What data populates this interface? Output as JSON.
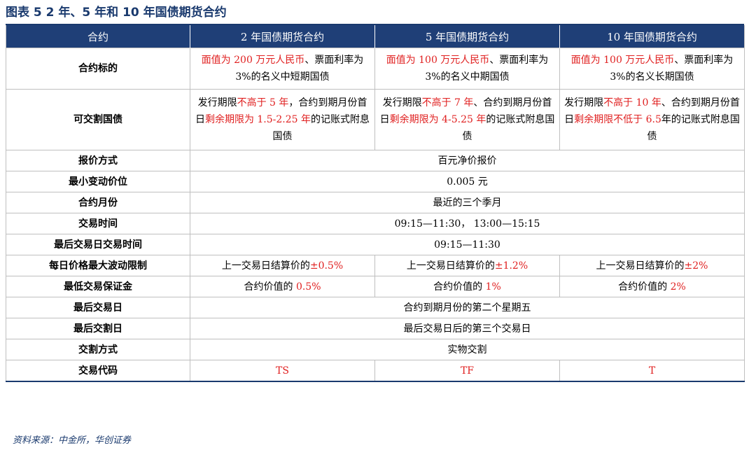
{
  "figure": {
    "title": "图表 5   2 年、5 年和 10 年国债期货合约",
    "source": "资料来源：中金所，华创证券"
  },
  "header": [
    "合约",
    "2 年国债期货合约",
    "5 年国债期货合约",
    "10 年国债期货合约"
  ],
  "rows": {
    "underlying": {
      "label": "合约标的",
      "c1": {
        "a": "面值为 200 万元人民币",
        "b": "、票面利率为 3%的名义中短期国债"
      },
      "c2": {
        "a": "面值为 100 万元人民币",
        "b": "、票面利率为 3%的名义中期国债"
      },
      "c3": {
        "a": "面值为 100 万元人民币",
        "b": "、票面利率为 3%的名义长期国债"
      }
    },
    "deliverable": {
      "label": "可交割国债",
      "c1": {
        "a": "发行期限",
        "b": "不高于 5 年",
        "c": "，合约到期月份首日",
        "d": "剩余期限为 1.5-2.25 年",
        "e": "的记账式附息国债"
      },
      "c2": {
        "a": "发行期限",
        "b": "不高于 7 年",
        "c": "、合约到期月份首日",
        "d": "剩余期限为 4-5.25 年",
        "e": "的记账式附息国债"
      },
      "c3": {
        "a": "发行期限",
        "b": "不高于 10 年",
        "c": "、合约到期月份首日",
        "d": "剩余期限不低于 6.5",
        "e": "年的记账式附息国债"
      }
    },
    "quote": {
      "label": "报价方式",
      "value": "百元净价报价"
    },
    "tick": {
      "label": "最小变动价位",
      "value": "0.005 元"
    },
    "months": {
      "label": "合约月份",
      "value": "最近的三个季月"
    },
    "hours": {
      "label": "交易时间",
      "value": "09:15—11:30， 13:00—15:15"
    },
    "last_day_hours": {
      "label": "最后交易日交易时间",
      "value": "09:15—11:30"
    },
    "limit": {
      "label": "每日价格最大波动限制",
      "prefix": "上一交易日结算价的",
      "c1": "±0.5%",
      "c2": "±1.2%",
      "c3": "±2%"
    },
    "margin": {
      "label": "最低交易保证金",
      "prefix": "合约价值的",
      "c1": "0.5%",
      "c2": "1%",
      "c3": "2%"
    },
    "last_trade": {
      "label": "最后交易日",
      "value": "合约到期月份的第二个星期五"
    },
    "last_delivery": {
      "label": "最后交割日",
      "value": "最后交易日后的第三个交易日"
    },
    "delivery_method": {
      "label": "交割方式",
      "value": "实物交割"
    },
    "code": {
      "label": "交易代码",
      "c1": "TS",
      "c2": "TF",
      "c3": "T"
    }
  },
  "colors": {
    "header_bg": "#1f3f77",
    "title": "#1a3a6e",
    "highlight": "#e02020"
  }
}
